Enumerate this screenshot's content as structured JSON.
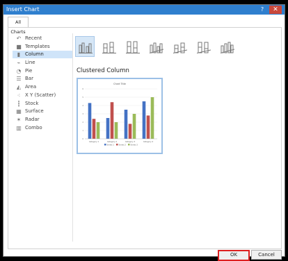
{
  "window": {
    "title": "Insert Chart",
    "help_label": "?",
    "close_label": "✕"
  },
  "tabs": [
    {
      "label": "All Charts"
    }
  ],
  "chart_types": [
    {
      "label": "Recent",
      "icon": "recent-icon"
    },
    {
      "label": "Templates",
      "icon": "folder-icon"
    },
    {
      "label": "Column",
      "icon": "column-chart-icon"
    },
    {
      "label": "Line",
      "icon": "line-chart-icon"
    },
    {
      "label": "Pie",
      "icon": "pie-chart-icon"
    },
    {
      "label": "Bar",
      "icon": "bar-chart-icon"
    },
    {
      "label": "Area",
      "icon": "area-chart-icon"
    },
    {
      "label": "X Y (Scatter)",
      "icon": "scatter-chart-icon"
    },
    {
      "label": "Stock",
      "icon": "stock-chart-icon"
    },
    {
      "label": "Surface",
      "icon": "surface-chart-icon"
    },
    {
      "label": "Radar",
      "icon": "radar-chart-icon"
    },
    {
      "label": "Combo",
      "icon": "combo-chart-icon"
    }
  ],
  "selected_chart_type": "Column",
  "subtypes_title": "Clustered Column",
  "preview": {
    "colors": [
      "#4472c4",
      "#c0504d",
      "#9bbb59"
    ],
    "chart_data": {
      "type": "bar",
      "title": "Chart Title",
      "categories": [
        "Category 1",
        "Category 2",
        "Category 3",
        "Category 4"
      ],
      "series": [
        {
          "name": "Series 1",
          "values": [
            4.3,
            2.5,
            3.5,
            4.5
          ]
        },
        {
          "name": "Series 2",
          "values": [
            2.4,
            4.4,
            1.8,
            2.8
          ]
        },
        {
          "name": "Series 3",
          "values": [
            2.0,
            2.0,
            3.0,
            5.0
          ]
        }
      ],
      "ylim": [
        0,
        6
      ]
    }
  },
  "buttons": {
    "ok_label": "OK",
    "cancel_label": "Cancel"
  }
}
